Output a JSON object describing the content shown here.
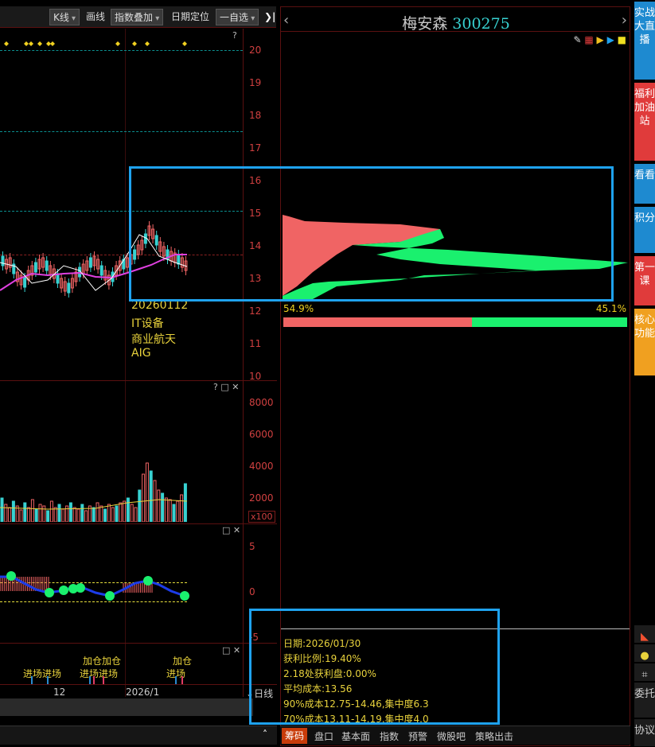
{
  "toolbar": {
    "kline": "K线",
    "draw": "画线",
    "overlay": "指数叠加",
    "date_locate": "日期定位",
    "watchlist": "一自选",
    "collapse": "K"
  },
  "kline_chart": {
    "y_ticks": [
      "20",
      "19",
      "18",
      "17",
      "16",
      "15",
      "14",
      "13",
      "12",
      "11",
      "10"
    ],
    "annotations": [
      "20260112",
      "IT设备",
      "商业航天",
      "AIG"
    ],
    "help": "?"
  },
  "volume_chart": {
    "y_ticks": [
      "8000",
      "6000",
      "4000",
      "2000"
    ],
    "unit": "x100",
    "controls": "? □ ✕"
  },
  "indicator_chart": {
    "y_ticks": [
      "5",
      "0",
      "-5"
    ],
    "controls": "□ ✕"
  },
  "signal_chart": {
    "labels": [
      "进场进场",
      "加仓加仓",
      "进场进场",
      "加仓",
      "进场"
    ],
    "controls": "□ ✕"
  },
  "time_axis": {
    "ticks": [
      "12",
      "2026/1"
    ],
    "period": "日线"
  },
  "stock": {
    "name": "梅安森",
    "code": "300275"
  },
  "chip": {
    "profit_pct_label": "54.9%",
    "loss_pct_label": "45.1%",
    "profit_ratio": 0.549,
    "date": "日期:2026/01/30",
    "profit_ratio_text": "获利比例:19.40%",
    "profit_at": "2.18处获利盘:0.00%",
    "avg_cost": "平均成本:13.56",
    "cost90": "90%成本12.75-14.46,集中度6.3",
    "cost70": "70%成本13.11-14.19,集中度4.0"
  },
  "tabs": [
    "筹码",
    "盘口",
    "基本面",
    "指数",
    "预警",
    "微股吧",
    "策略出击"
  ],
  "sidebar": [
    "实战大直播",
    "福利加油站",
    "看看",
    "积分",
    "第一课",
    "核心功能",
    "委托",
    "协议"
  ],
  "colors": {
    "profit": "#f06464",
    "loss": "#1af06e",
    "highlight": "#1fa2ee"
  }
}
